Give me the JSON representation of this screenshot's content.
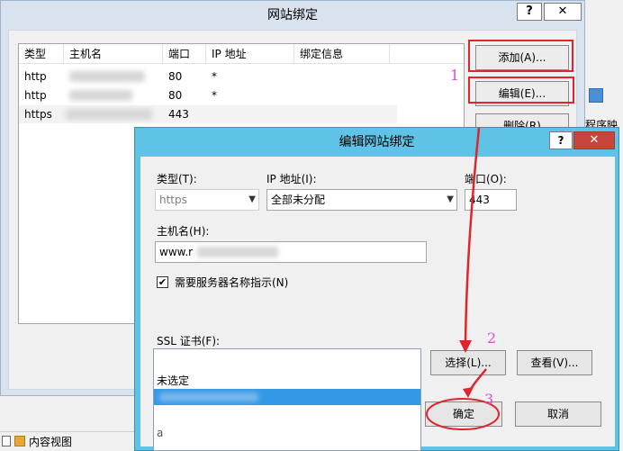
{
  "outer_dialog": {
    "title": "网站绑定",
    "help": "?",
    "close": "✕",
    "columns": [
      "类型",
      "主机名",
      "端口",
      "IP 地址",
      "绑定信息"
    ],
    "rows": [
      {
        "type": "http",
        "port": "80",
        "ip": "*"
      },
      {
        "type": "http",
        "port": "80",
        "ip": "*"
      },
      {
        "type": "https",
        "port": "443",
        "ip": ""
      }
    ],
    "buttons": {
      "add": "添加(A)...",
      "edit": "编辑(E)...",
      "remove": "删除(R)"
    }
  },
  "annotations": {
    "step1": "1",
    "step2": "2",
    "step3": "3"
  },
  "inner_dialog": {
    "title": "编辑网站绑定",
    "help": "?",
    "close": "✕",
    "type_label": "类型(T):",
    "type_value": "https",
    "ip_label": "IP 地址(I):",
    "ip_value": "全部未分配",
    "port_label": "端口(O):",
    "port_value": "443",
    "host_label": "主机名(H):",
    "host_value": "www.r",
    "sni_label": "需要服务器名称指示(N)",
    "sni_checked": "✔",
    "ssl_label": "SSL 证书(F):",
    "ssl_options": [
      "未选定",
      "",
      "",
      "a"
    ],
    "select_button": "选择(L)...",
    "view_button": "查看(V)...",
    "ok_button": "确定",
    "cancel_button": "取消"
  },
  "background": {
    "taskbar_item": "内容视图",
    "side_text": "程序映"
  },
  "colors": {
    "accent_red": "#e0242c",
    "annotation_pink": "#e04bd0",
    "selected_blue": "#3399e6"
  }
}
